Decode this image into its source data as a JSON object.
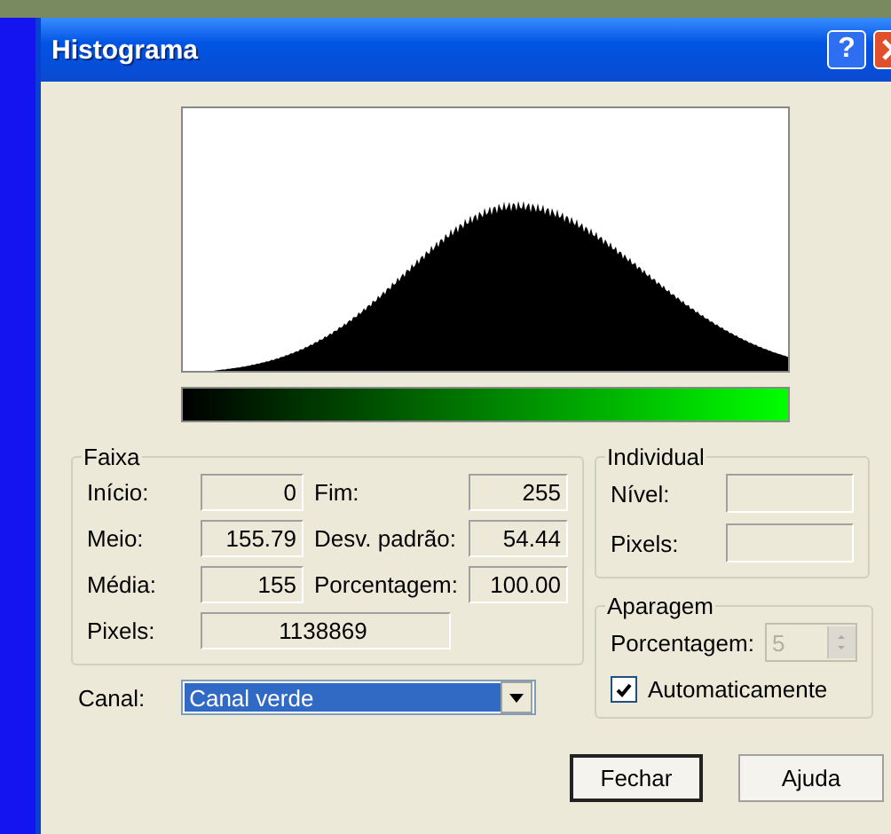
{
  "window": {
    "title": "Histograma",
    "help_button": "?"
  },
  "range": {
    "title": "Faixa",
    "fields": [
      {
        "label": "Início:",
        "value": "0"
      },
      {
        "label": "Fim:",
        "value": "255"
      },
      {
        "label": "Meio:",
        "value": "155.79"
      },
      {
        "label": "Desv. padrão:",
        "value": "54.44"
      },
      {
        "label": "Média:",
        "value": "155"
      },
      {
        "label": "Porcentagem:",
        "value": "100.00"
      },
      {
        "label": "Pixels:",
        "value": "1138869"
      }
    ]
  },
  "individual": {
    "title": "Individual",
    "fields": [
      {
        "label": "Nível:"
      },
      {
        "label": "Pixels:"
      }
    ]
  },
  "clipping": {
    "title": "Aparagem",
    "percent_label": "Porcentagem:",
    "percent_value": "5",
    "disabled": true,
    "auto": {
      "label": "Automaticamente",
      "checked": true
    }
  },
  "channel": {
    "label": "Canal:",
    "value": "Canal verde",
    "focused": true
  },
  "buttons": [
    {
      "label": "Fechar",
      "default": true
    },
    {
      "label": "Ajuda",
      "default": false
    }
  ]
}
